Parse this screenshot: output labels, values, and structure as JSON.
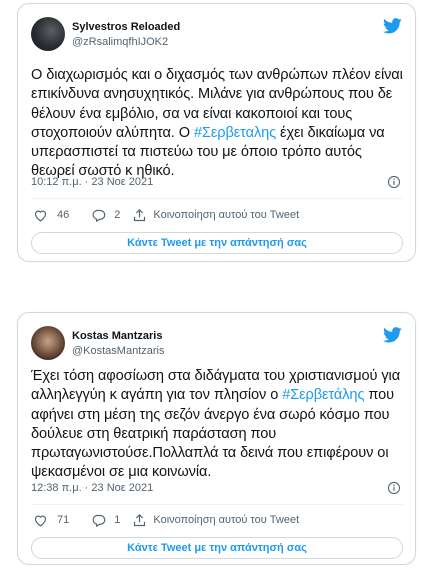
{
  "tweets": [
    {
      "name": "Sylvestros Reloaded",
      "handle": "@zRsalimqfhIJOK2",
      "text_parts": [
        "Ο διαχωρισμός και ο διχασμός των ανθρώπων πλέον είναι επικίνδυνα ανησυχητικός. Μιλάνε για ανθρώπους που δε θέλουν ένα εμβόλιο, σα να είναι κακοποιοί και τους στοχοποιούν αλύπητα. Ο ",
        "#Σερβεταλης",
        " έχει δικαίωμα να υπερασπιστεί τα πιστεύω του με όποιο τρόπο αυτός θεωρεί σωστό κ ηθικό."
      ],
      "timestamp": "10:12 π.μ. · 23 Νοε 2021",
      "likes": "46",
      "replies": "2",
      "share_label": "Κοινοποίηση αυτού του Tweet",
      "reply_button": "Κάντε Tweet με την απάντησή σας"
    },
    {
      "name": "Kostas Mantzaris",
      "handle": "@KostasMantzaris",
      "text_parts": [
        "Έχει τόση αφοσίωση στα διδάγματα του χριστιανισμού για αλληλεγγύη κ αγάπη για τον πλησίον ο ",
        "#Σερβετάλης",
        " που αφήνει στη μέση της σεζόν άνεργο ένα σωρό κόσμο που δούλευε στη θεατρική παράσταση που πρωταγωνιστούσε.Πολλαπλά τα δεινά που επιφέρουν οι ψεκασμένοι σε μια κοινωνία."
      ],
      "timestamp": "12:38 π.μ. · 23 Νοε 2021",
      "likes": "71",
      "replies": "1",
      "share_label": "Κοινοποίηση αυτού του Tweet",
      "reply_button": "Κάντε Tweet με την απάντησή σας"
    }
  ],
  "icons": {
    "brand": "twitter-bird-icon",
    "info": "info-icon",
    "like": "heart-icon",
    "reply": "reply-bubble-icon",
    "share": "share-icon"
  },
  "colors": {
    "accent": "#1d9bf0",
    "text": "#0f1419",
    "muted": "#536471",
    "border": "#cfd9de"
  }
}
